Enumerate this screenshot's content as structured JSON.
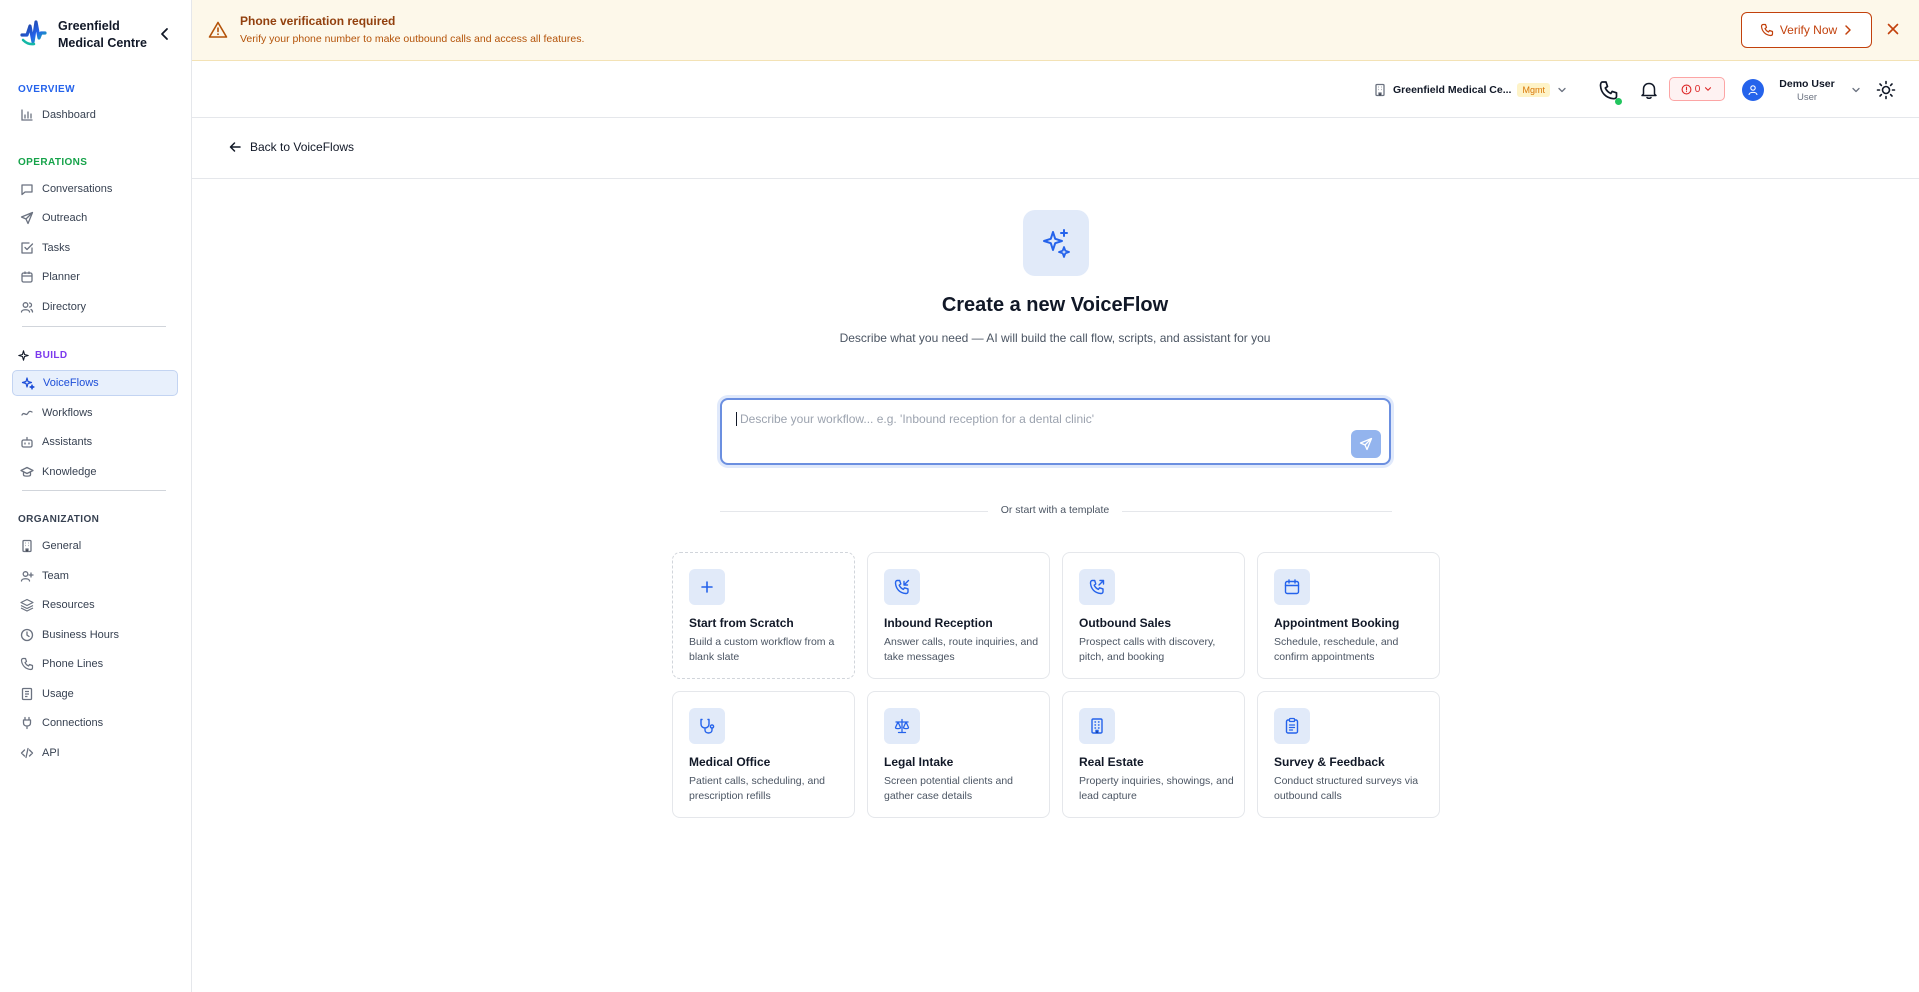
{
  "brand": {
    "name": "Greenfield Medical Centre"
  },
  "colors": {
    "accent": "#2563eb",
    "overview": "#2563eb",
    "operations": "#16a34a",
    "build": "#7c3aed",
    "organization": "#374151"
  },
  "sidebar": {
    "sections": {
      "overview": "OVERVIEW",
      "operations": "OPERATIONS",
      "build": "BUILD",
      "organization": "ORGANIZATION"
    },
    "items": {
      "dashboard": "Dashboard",
      "conversations": "Conversations",
      "outreach": "Outreach",
      "tasks": "Tasks",
      "planner": "Planner",
      "directory": "Directory",
      "voiceflows": "VoiceFlows",
      "workflows": "Workflows",
      "assistants": "Assistants",
      "knowledge": "Knowledge",
      "general": "General",
      "team": "Team",
      "resources": "Resources",
      "business_hours": "Business Hours",
      "phone_lines": "Phone Lines",
      "usage": "Usage",
      "connections": "Connections",
      "api": "API"
    },
    "active": "VoiceFlows"
  },
  "banner": {
    "title": "Phone verification required",
    "text": "Verify your phone number to make outbound calls and access all features.",
    "button": "Verify Now"
  },
  "topbar": {
    "org_name": "Greenfield Medical Ce...",
    "org_badge": "Mgmt",
    "alert_count": "0",
    "user_name": "Demo User",
    "user_role": "User"
  },
  "subheader": {
    "back_label": "Back to VoiceFlows"
  },
  "main": {
    "title": "Create a new VoiceFlow",
    "subtitle": "Describe what you need — AI will build the call flow, scripts, and assistant for you",
    "prompt_placeholder": "Describe your workflow... e.g. 'Inbound reception for a dental clinic'",
    "prompt_value": "",
    "separator": "Or start with a template"
  },
  "templates": [
    {
      "title": "Start from Scratch",
      "desc": "Build a custom workflow from a blank slate",
      "icon": "plus-icon"
    },
    {
      "title": "Inbound Reception",
      "desc": "Answer calls, route inquiries, and take messages",
      "icon": "phone-incoming-icon"
    },
    {
      "title": "Outbound Sales",
      "desc": "Prospect calls with discovery, pitch, and booking",
      "icon": "phone-outgoing-icon"
    },
    {
      "title": "Appointment Booking",
      "desc": "Schedule, reschedule, and confirm appointments",
      "icon": "calendar-icon"
    },
    {
      "title": "Medical Office",
      "desc": "Patient calls, scheduling, and prescription refills",
      "icon": "stethoscope-icon"
    },
    {
      "title": "Legal Intake",
      "desc": "Screen potential clients and gather case details",
      "icon": "scale-icon"
    },
    {
      "title": "Real Estate",
      "desc": "Property inquiries, showings, and lead capture",
      "icon": "building-icon"
    },
    {
      "title": "Survey & Feedback",
      "desc": "Conduct structured surveys via outbound calls",
      "icon": "clipboard-icon"
    }
  ]
}
